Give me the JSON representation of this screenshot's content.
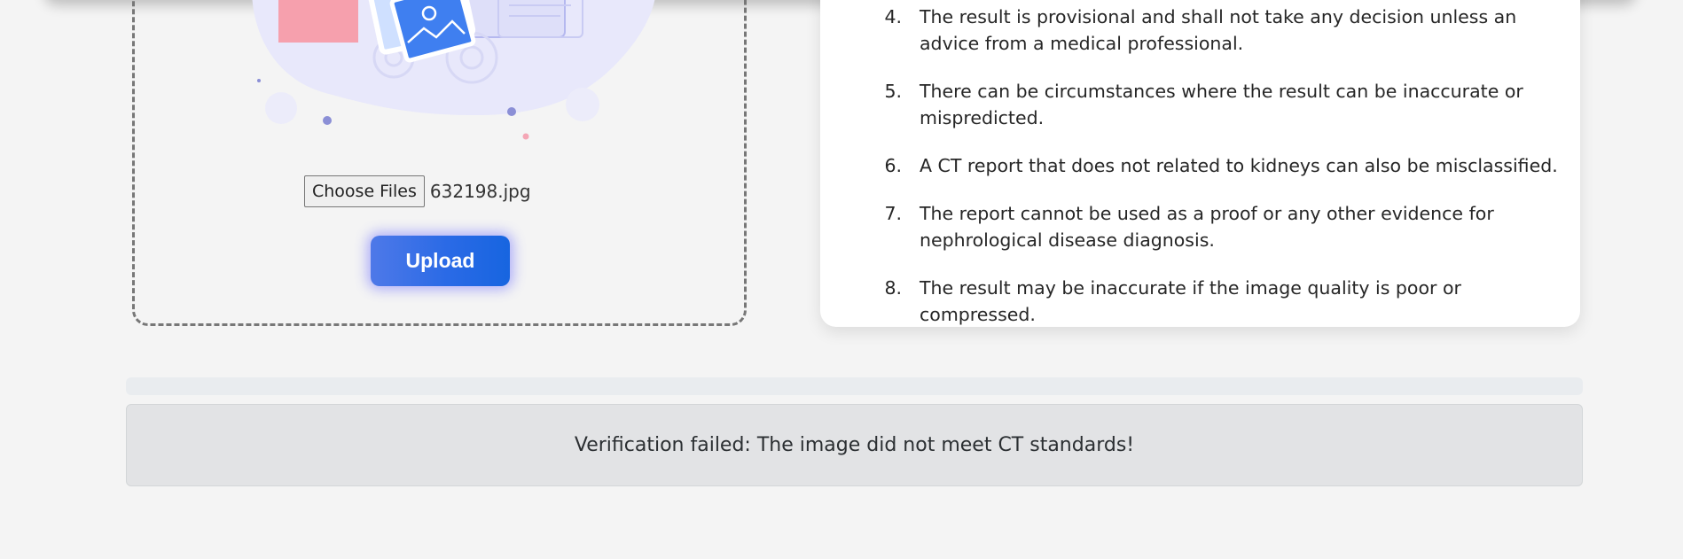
{
  "upload": {
    "choose_files_label": "Choose Files",
    "file_name": "632198.jpg",
    "upload_label": "Upload"
  },
  "disclaimer": {
    "items": [
      {
        "num": "4.",
        "text": "The result is provisional and shall not take any decision unless an advice from a medical professional."
      },
      {
        "num": "5.",
        "text": "There can be circumstances where the result can be inaccurate or mispredicted."
      },
      {
        "num": "6.",
        "text": "A CT report that does not related to kidneys can also be misclassified."
      },
      {
        "num": "7.",
        "text": "The report cannot be used as a proof or any other evidence for nephrological disease diagnosis."
      },
      {
        "num": "8.",
        "text": "The result may be inaccurate if the image quality is poor or compressed."
      }
    ]
  },
  "status": {
    "progress": 0,
    "alert_text": "Verification failed: The image did not meet CT standards!"
  },
  "colors": {
    "upload_button": "#2a6ae6",
    "alert_bg": "#e2e3e5",
    "progress_track": "#e9ecef"
  }
}
